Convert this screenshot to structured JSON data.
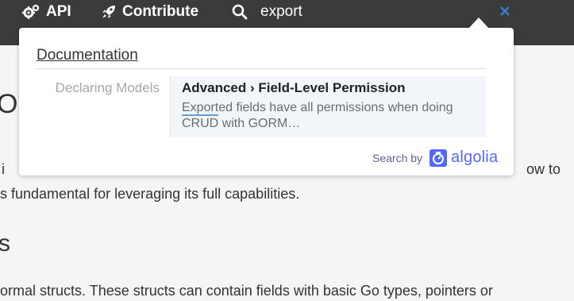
{
  "nav": {
    "api_label": "API",
    "contribute_label": "Contribute",
    "search_value": "export"
  },
  "page": {
    "heading1": "O",
    "para1_start": "i",
    "para1_end": "ow to",
    "para2": "s fundamental for leveraging its full capabilities.",
    "heading2": "s",
    "para3": "ormal structs. These structs can contain fields with basic Go types, pointers or"
  },
  "dropdown": {
    "category": "Documentation",
    "result": {
      "subcategory": "Declaring Models",
      "title": "Advanced › Field-Level Permission",
      "snippet_highlight": "Export",
      "snippet_rest_line1": "ed fields have all permissions when doing",
      "snippet_line2": "CRUD with GORM…"
    },
    "search_by": "Search by",
    "algolia": "algolia"
  },
  "colors": {
    "nav_bg": "#3b3b3b",
    "highlight_underline": "#5a9fd6",
    "algolia_blue": "#5468ff",
    "close_icon": "#3b7bd0"
  },
  "icons": [
    "gears-icon",
    "rocket-icon",
    "search-icon",
    "close-icon",
    "algolia-stopwatch-icon"
  ]
}
